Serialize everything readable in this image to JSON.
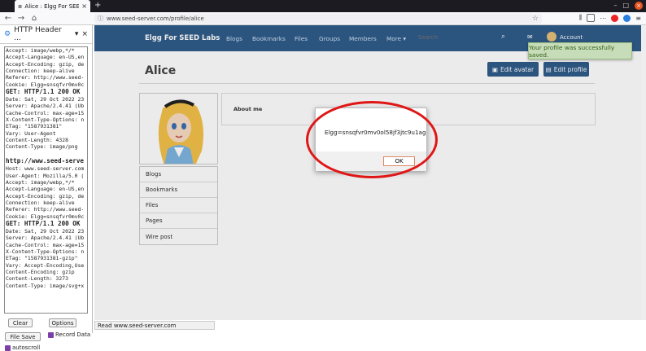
{
  "browser": {
    "tab_title": "Alice : Elgg For SEED Lab",
    "url": "www.seed-server.com/profile/alice",
    "status": "Read www.seed-server.com"
  },
  "sidebar": {
    "title": "HTTP Header ...",
    "log": [
      {
        "t": "Accept: image/webp,*/*"
      },
      {
        "t": "Accept-Language: en-US,en"
      },
      {
        "t": "Accept-Encoding: gzip, de"
      },
      {
        "t": "Connection: keep-alive"
      },
      {
        "t": "Referer: http://www.seed-"
      },
      {
        "t": "Cookie: Elgg=snsqfvr0mv0c"
      },
      {
        "t": "GET: HTTP/1.1 200 OK",
        "h": true
      },
      {
        "t": "Date: Sat, 29 Oct 2022 23"
      },
      {
        "t": "Server: Apache/2.4.41 (Ub"
      },
      {
        "t": "Cache-Control: max-age=15"
      },
      {
        "t": "X-Content-Type-Options: n"
      },
      {
        "t": "ETag: \"1587931381\""
      },
      {
        "t": "Vary: User-Agent"
      },
      {
        "t": "Content-Length: 4328"
      },
      {
        "t": "Content-Type: image/png"
      },
      {
        "t": ""
      },
      {
        "t": "http://www.seed-serve",
        "h": true
      },
      {
        "t": "Host: www.seed-server.com"
      },
      {
        "t": "User-Agent: Mozilla/5.0 ("
      },
      {
        "t": "Accept: image/webp,*/*"
      },
      {
        "t": "Accept-Language: en-US,en"
      },
      {
        "t": "Accept-Encoding: gzip, de"
      },
      {
        "t": "Connection: keep-alive"
      },
      {
        "t": "Referer: http://www.seed-"
      },
      {
        "t": "Cookie: Elgg=snsqfvr0mv0c"
      },
      {
        "t": "GET: HTTP/1.1 200 OK",
        "h": true
      },
      {
        "t": "Date: Sat, 29 Oct 2022 23"
      },
      {
        "t": "Server: Apache/2.4.41 (Ub"
      },
      {
        "t": "Cache-Control: max-age=15"
      },
      {
        "t": "X-Content-Type-Options: n"
      },
      {
        "t": "ETag: \"1587931381-gzip\""
      },
      {
        "t": "Vary: Accept-Encoding,Use"
      },
      {
        "t": "Content-Encoding: gzip"
      },
      {
        "t": "Content-Length: 3273"
      },
      {
        "t": "Content-Type: image/svg+x"
      }
    ],
    "clear": "Clear",
    "options": "Options",
    "file_save": "File Save",
    "record_data": "Record Data",
    "autoscroll": "autoscroll"
  },
  "site": {
    "name": "Elgg For SEED Labs",
    "menu": [
      "Blogs",
      "Bookmarks",
      "Files",
      "Groups",
      "Members",
      "More ▾"
    ],
    "search_placeholder": "Search",
    "account": "Account"
  },
  "toast": "Your profile was successfully saved.",
  "profile": {
    "name": "Alice",
    "edit_avatar": "Edit avatar",
    "edit_profile": "Edit profile",
    "about_label": "About me",
    "menu": [
      "Blogs",
      "Bookmarks",
      "Files",
      "Pages",
      "Wire post"
    ]
  },
  "dialog": {
    "message": "Elgg=snsqfvr0mv0ol58jf3jtc9u1ag",
    "ok": "OK"
  }
}
